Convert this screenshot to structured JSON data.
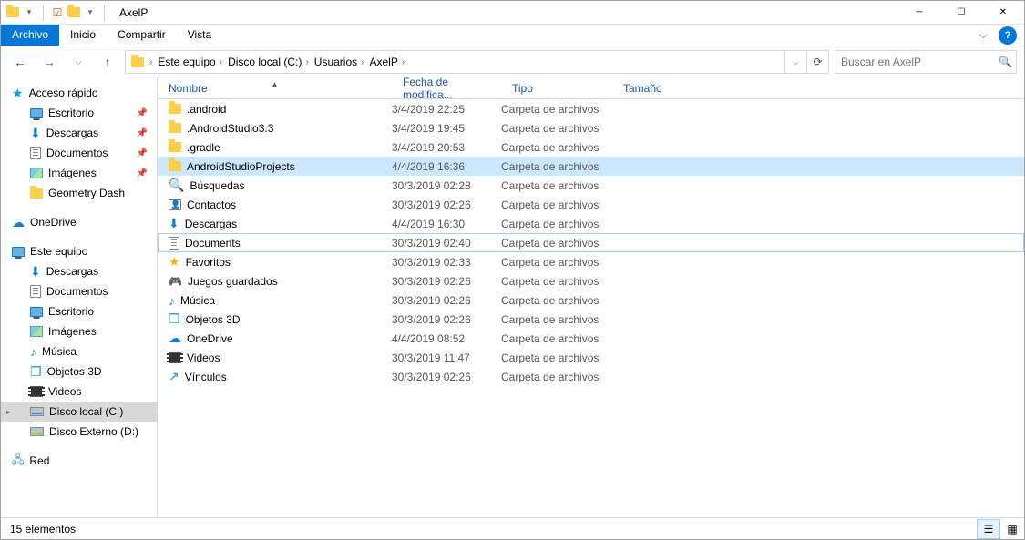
{
  "window": {
    "title": "AxelP"
  },
  "ribbon": {
    "file": "Archivo",
    "home": "Inicio",
    "share": "Compartir",
    "view": "Vista"
  },
  "breadcrumbs": [
    "Este equipo",
    "Disco local (C:)",
    "Usuarios",
    "AxelP"
  ],
  "search": {
    "placeholder": "Buscar en AxelP"
  },
  "sidebar": {
    "quick": "Acceso rápido",
    "quick_items": [
      {
        "label": "Escritorio",
        "icon": "monitor",
        "pinned": true
      },
      {
        "label": "Descargas",
        "icon": "down",
        "pinned": true
      },
      {
        "label": "Documentos",
        "icon": "doc",
        "pinned": true
      },
      {
        "label": "Imágenes",
        "icon": "img",
        "pinned": true
      },
      {
        "label": "Geometry Dash",
        "icon": "folder",
        "pinned": false
      }
    ],
    "onedrive": "OneDrive",
    "thispc": "Este equipo",
    "thispc_items": [
      {
        "label": "Descargas",
        "icon": "down"
      },
      {
        "label": "Documentos",
        "icon": "doc"
      },
      {
        "label": "Escritorio",
        "icon": "monitor"
      },
      {
        "label": "Imágenes",
        "icon": "img"
      },
      {
        "label": "Música",
        "icon": "music"
      },
      {
        "label": "Objetos 3D",
        "icon": "cube"
      },
      {
        "label": "Videos",
        "icon": "video"
      },
      {
        "label": "Disco local (C:)",
        "icon": "drive"
      },
      {
        "label": "Disco Externo (D:)",
        "icon": "drive-ext"
      }
    ],
    "network": "Red"
  },
  "columns": {
    "name": "Nombre",
    "date": "Fecha de modifica...",
    "type": "Tipo",
    "size": "Tamaño"
  },
  "rows": [
    {
      "icon": "folder",
      "name": ".android",
      "date": "3/4/2019 22:25",
      "type": "Carpeta de archivos",
      "sel": "",
      "out": ""
    },
    {
      "icon": "folder",
      "name": ".AndroidStudio3.3",
      "date": "3/4/2019 19:45",
      "type": "Carpeta de archivos",
      "sel": "",
      "out": ""
    },
    {
      "icon": "folder",
      "name": ".gradle",
      "date": "3/4/2019 20:53",
      "type": "Carpeta de archivos",
      "sel": "",
      "out": ""
    },
    {
      "icon": "folder",
      "name": "AndroidStudioProjects",
      "date": "4/4/2019 16:36",
      "type": "Carpeta de archivos",
      "sel": "selected",
      "out": ""
    },
    {
      "icon": "search",
      "name": "Búsquedas",
      "date": "30/3/2019 02:28",
      "type": "Carpeta de archivos",
      "sel": "",
      "out": ""
    },
    {
      "icon": "contacts",
      "name": "Contactos",
      "date": "30/3/2019 02:26",
      "type": "Carpeta de archivos",
      "sel": "",
      "out": ""
    },
    {
      "icon": "down",
      "name": "Descargas",
      "date": "4/4/2019 16:30",
      "type": "Carpeta de archivos",
      "sel": "",
      "out": ""
    },
    {
      "icon": "doc",
      "name": "Documents",
      "date": "30/3/2019 02:40",
      "type": "Carpeta de archivos",
      "sel": "",
      "out": "outlined"
    },
    {
      "icon": "favstar",
      "name": "Favoritos",
      "date": "30/3/2019 02:33",
      "type": "Carpeta de archivos",
      "sel": "",
      "out": ""
    },
    {
      "icon": "game",
      "name": "Juegos guardados",
      "date": "30/3/2019 02:26",
      "type": "Carpeta de archivos",
      "sel": "",
      "out": ""
    },
    {
      "icon": "music",
      "name": "Música",
      "date": "30/3/2019 02:26",
      "type": "Carpeta de archivos",
      "sel": "",
      "out": ""
    },
    {
      "icon": "cube",
      "name": "Objetos 3D",
      "date": "30/3/2019 02:26",
      "type": "Carpeta de archivos",
      "sel": "",
      "out": ""
    },
    {
      "icon": "cloud",
      "name": "OneDrive",
      "date": "4/4/2019 08:52",
      "type": "Carpeta de archivos",
      "sel": "",
      "out": ""
    },
    {
      "icon": "video",
      "name": "Videos",
      "date": "30/3/2019 11:47",
      "type": "Carpeta de archivos",
      "sel": "",
      "out": ""
    },
    {
      "icon": "link",
      "name": "Vínculos",
      "date": "30/3/2019 02:26",
      "type": "Carpeta de archivos",
      "sel": "",
      "out": ""
    }
  ],
  "status": "15 elementos"
}
